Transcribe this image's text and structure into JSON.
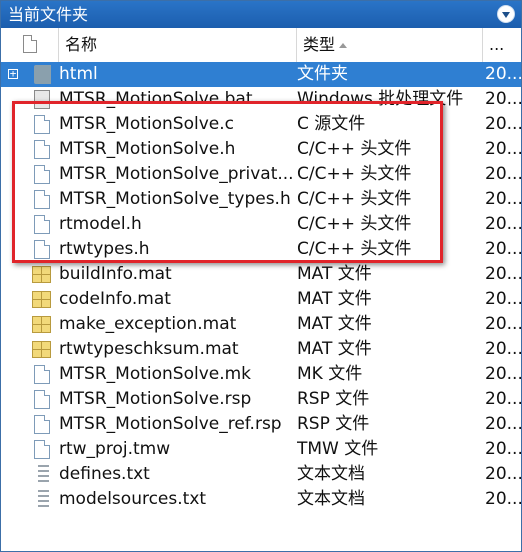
{
  "panel": {
    "title": "当前文件夹"
  },
  "columns": {
    "name": "名称",
    "type": "类型",
    "date": "..."
  },
  "rows": [
    {
      "name": "html",
      "type": "文件夹",
      "date": "20...",
      "icon": "folder-icon",
      "selected": true,
      "expandable": true
    },
    {
      "name": "MTSR_MotionSolve.bat",
      "type": "Windows 批处理文件",
      "date": "20...",
      "icon": "batch-file-icon"
    },
    {
      "name": "MTSR_MotionSolve.c",
      "type": "C 源文件",
      "date": "20...",
      "icon": "file-icon"
    },
    {
      "name": "MTSR_MotionSolve.h",
      "type": "C/C++ 头文件",
      "date": "20...",
      "icon": "file-icon"
    },
    {
      "name": "MTSR_MotionSolve_privat...",
      "type": "C/C++ 头文件",
      "date": "20...",
      "icon": "file-icon"
    },
    {
      "name": "MTSR_MotionSolve_types.h",
      "type": "C/C++ 头文件",
      "date": "20...",
      "icon": "file-icon"
    },
    {
      "name": "rtmodel.h",
      "type": "C/C++ 头文件",
      "date": "20...",
      "icon": "file-icon"
    },
    {
      "name": "rtwtypes.h",
      "type": "C/C++ 头文件",
      "date": "20...",
      "icon": "file-icon"
    },
    {
      "name": "buildInfo.mat",
      "type": "MAT 文件",
      "date": "20...",
      "icon": "mat-file-icon"
    },
    {
      "name": "codeInfo.mat",
      "type": "MAT 文件",
      "date": "20...",
      "icon": "mat-file-icon"
    },
    {
      "name": "make_exception.mat",
      "type": "MAT 文件",
      "date": "20...",
      "icon": "mat-file-icon"
    },
    {
      "name": "rtwtypeschksum.mat",
      "type": "MAT 文件",
      "date": "20...",
      "icon": "mat-file-icon"
    },
    {
      "name": "MTSR_MotionSolve.mk",
      "type": "MK 文件",
      "date": "20...",
      "icon": "file-icon"
    },
    {
      "name": "MTSR_MotionSolve.rsp",
      "type": "RSP 文件",
      "date": "20...",
      "icon": "file-icon"
    },
    {
      "name": "MTSR_MotionSolve_ref.rsp",
      "type": "RSP 文件",
      "date": "20...",
      "icon": "file-icon"
    },
    {
      "name": "rtw_proj.tmw",
      "type": "TMW 文件",
      "date": "20...",
      "icon": "file-icon"
    },
    {
      "name": "defines.txt",
      "type": "文本文档",
      "date": "20...",
      "icon": "text-file-icon"
    },
    {
      "name": "modelsources.txt",
      "type": "文本文档",
      "date": "20...",
      "icon": "text-file-icon"
    }
  ],
  "colors": {
    "titlebar": "#1f63b4",
    "selection": "#2f7fd2",
    "highlight_box": "#e0242a"
  }
}
